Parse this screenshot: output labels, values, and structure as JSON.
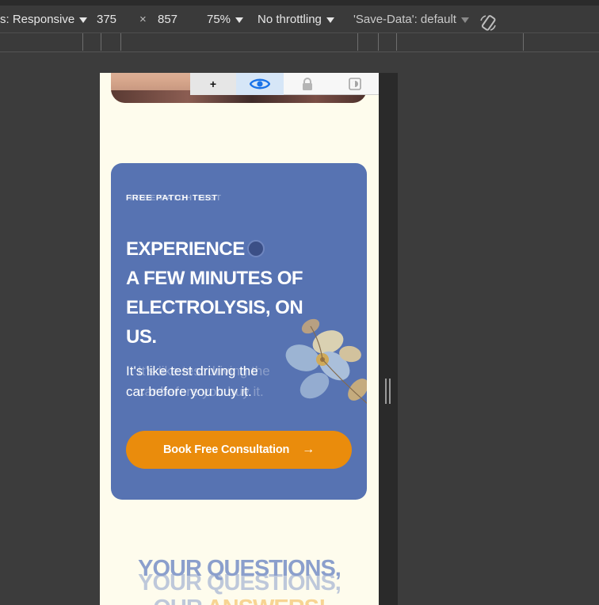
{
  "toolbar": {
    "dimensions_mode": "s: Responsive",
    "width": "375",
    "times": "×",
    "height": "857",
    "zoom": "75%",
    "throttling": "No throttling",
    "save_data": "'Save-Data': default"
  },
  "extension_bar": {
    "add_label": "+"
  },
  "card": {
    "eyebrow": "FREE PATCH TEST",
    "headline_lines": [
      "EXPERIENCE",
      "A FEW MINUTES OF",
      "ELECTROLYSIS, ON",
      "US."
    ],
    "subtext_line1": "It's like test driving the",
    "subtext_line2": "car before you buy it.",
    "cta_label": "Book Free Consultation",
    "cta_arrow": "→"
  },
  "faq": {
    "line1": "YOUR QUESTIONS,",
    "line2_prefix": "OUR",
    "line2_accent": "ANSWERS!"
  },
  "colors": {
    "card_bg": "#5773b2",
    "cta_bg": "#ea8c0c",
    "page_bg": "#fefced",
    "accent": "#f2b44a"
  }
}
